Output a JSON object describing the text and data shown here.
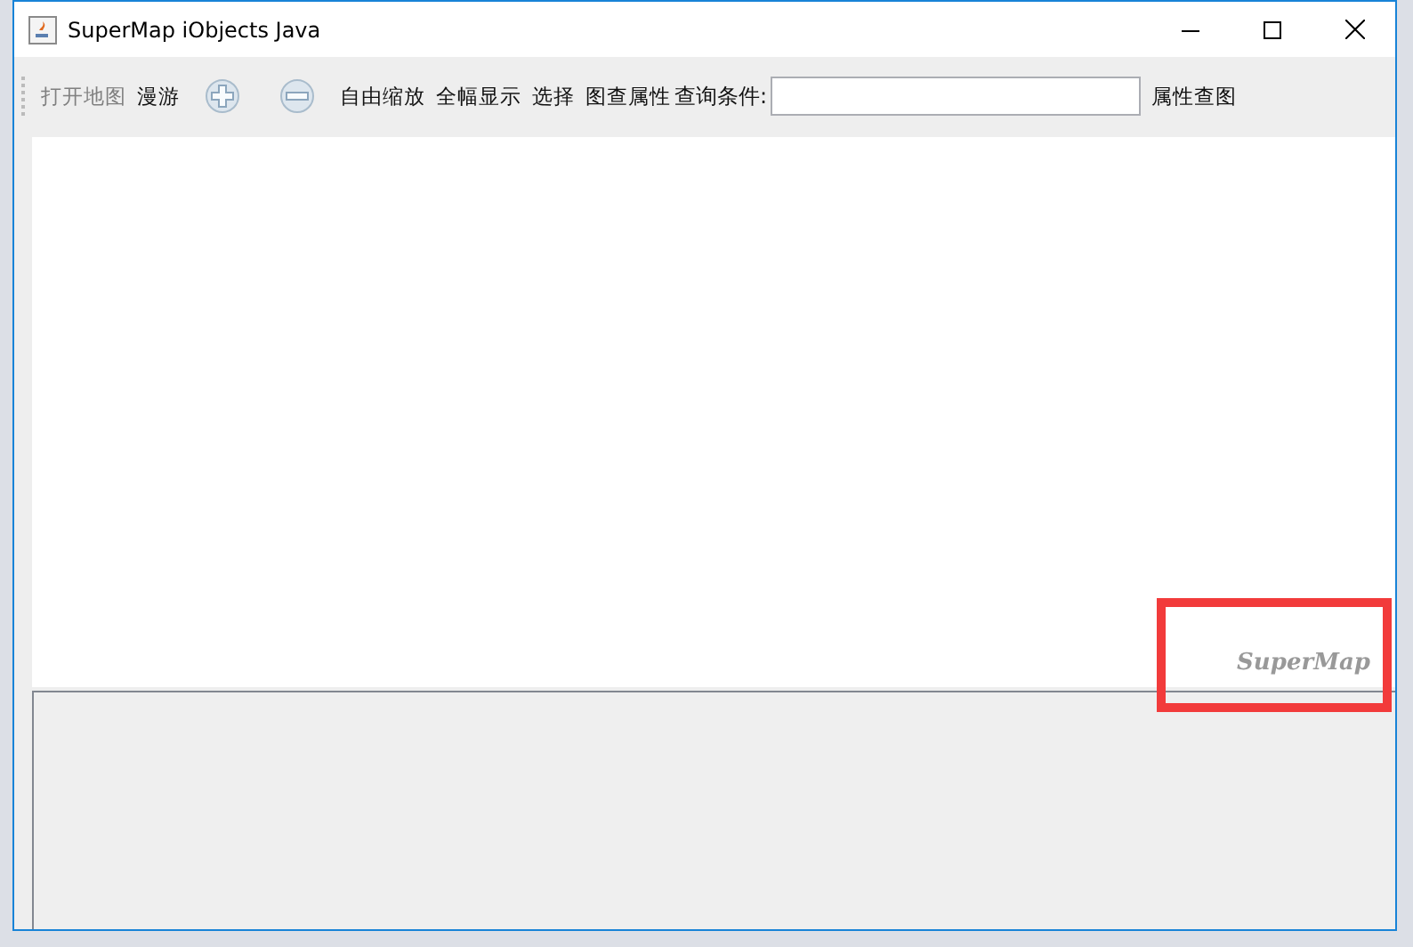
{
  "window": {
    "title": "SuperMap iObjects Java"
  },
  "toolbar": [
    {
      "kind": "button",
      "label": "打开地图",
      "disabled": true
    },
    {
      "kind": "button",
      "label": "漫游",
      "disabled": false
    },
    {
      "kind": "zoom-in"
    },
    {
      "kind": "zoom-out"
    },
    {
      "kind": "button",
      "label": "自由缩放",
      "disabled": false
    },
    {
      "kind": "button",
      "label": "全幅显示",
      "disabled": false
    },
    {
      "kind": "button",
      "label": "选择",
      "disabled": false
    },
    {
      "kind": "button",
      "label": "图查属性",
      "disabled": false
    },
    {
      "kind": "label",
      "label": "查询条件:"
    },
    {
      "kind": "field"
    },
    {
      "kind": "button",
      "label": "属性查图",
      "disabled": false
    }
  ],
  "map": {
    "logo": "SuperMap",
    "highlighted": true
  }
}
